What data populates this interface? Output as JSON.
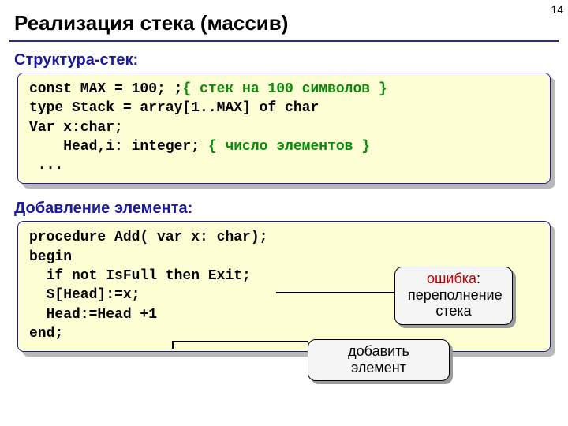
{
  "pageNumber": "14",
  "title": "Реализация стека (массив)",
  "section1": "Структура-стек:",
  "code1": {
    "l1a": "const MAX = 100; ;",
    "l1b": "{ стек на 100 символов }",
    "l2": "type Stack = array[1..MAX] of char",
    "l3": "Var x:char;",
    "l4a": "    Head,i: integer; ",
    "l4b": "{ число элементов }",
    "l5": " ..."
  },
  "section2": "Добавление элемента:",
  "code2": {
    "l1": "procedure Add( var x: char);",
    "l2": "begin",
    "l3": "  if not IsFull then Exit;",
    "l4": "  S[Head]:=x;",
    "l5": "  Head:=Head +1",
    "l6": "end;"
  },
  "calloutError": {
    "line1": "ошибка",
    "line2": "переполнение",
    "line3": "стека"
  },
  "calloutAdd": "добавить элемент"
}
